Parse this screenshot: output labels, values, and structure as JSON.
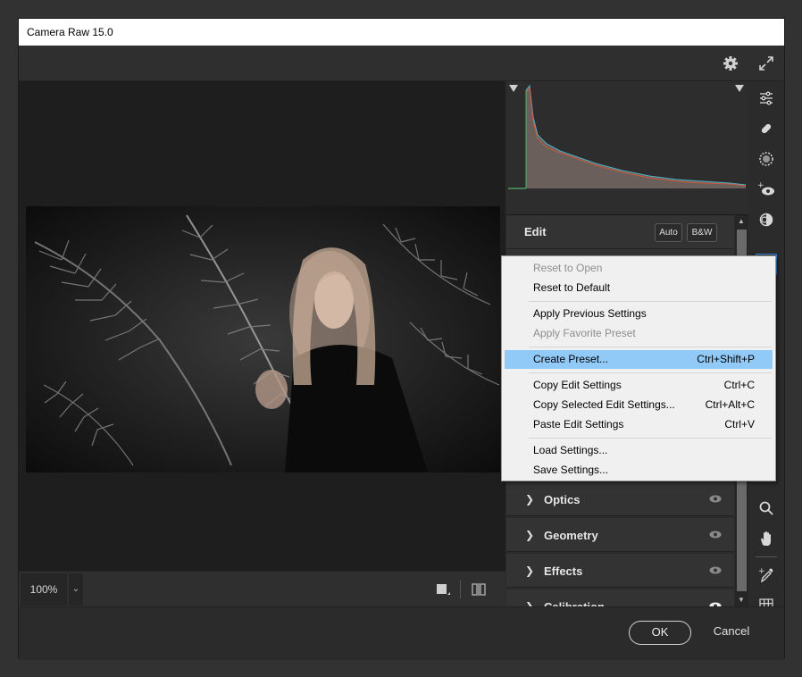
{
  "window": {
    "title": "Camera Raw 15.0"
  },
  "topbar": {
    "settings_icon": "gear-icon",
    "fullscreen_icon": "expand-icon"
  },
  "canvas": {
    "zoom_value": "100%",
    "zoom_dropdown_icon": "chevron-down-icon"
  },
  "edit_panel": {
    "title": "Edit",
    "auto_label": "Auto",
    "bw_label": "B&W",
    "sections": [
      {
        "label": "Optics",
        "eye": "eye-icon"
      },
      {
        "label": "Geometry",
        "eye": "eye-icon"
      },
      {
        "label": "Effects",
        "eye": "eye-icon"
      },
      {
        "label": "Calibration",
        "eye": "eye-icon"
      }
    ]
  },
  "tools": [
    "edit-sliders-icon",
    "healing-bandage-icon",
    "mask-icon",
    "red-eye-icon",
    "presets-icon",
    "more-options-icon",
    "zoom-icon",
    "hand-icon",
    "eyedropper-icon",
    "grid-icon"
  ],
  "context_menu": {
    "items": [
      {
        "label": "Reset to Open",
        "shortcut": "",
        "disabled": true
      },
      {
        "label": "Reset to Default",
        "shortcut": "",
        "disabled": false
      },
      {
        "label": "Apply Previous Settings",
        "shortcut": "",
        "disabled": false
      },
      {
        "label": "Apply Favorite Preset",
        "shortcut": "",
        "disabled": true
      },
      {
        "label": "Create Preset...",
        "shortcut": "Ctrl+Shift+P",
        "disabled": false,
        "highlighted": true
      },
      {
        "label": "Copy Edit Settings",
        "shortcut": "Ctrl+C",
        "disabled": false
      },
      {
        "label": "Copy Selected Edit Settings...",
        "shortcut": "Ctrl+Alt+C",
        "disabled": false
      },
      {
        "label": "Paste Edit Settings",
        "shortcut": "Ctrl+V",
        "disabled": false
      },
      {
        "label": "Load Settings...",
        "shortcut": "",
        "disabled": false
      },
      {
        "label": "Save Settings...",
        "shortcut": "",
        "disabled": false
      }
    ]
  },
  "footer": {
    "ok_label": "OK",
    "cancel_label": "Cancel"
  },
  "colors": {
    "accent": "#3b8ae6",
    "menu_highlight": "#91c9f7"
  }
}
